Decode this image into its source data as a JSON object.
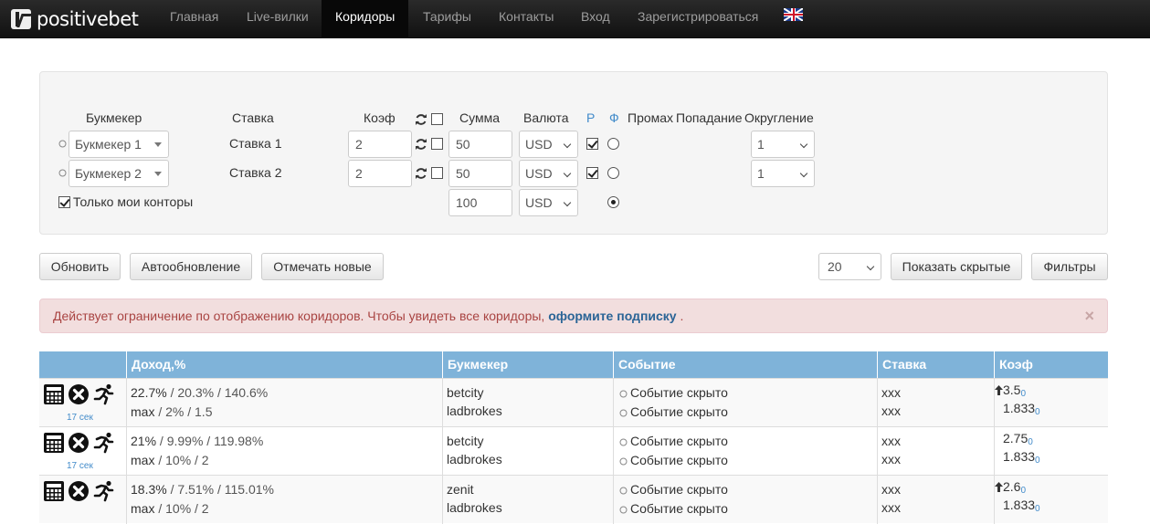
{
  "brand": "positivebet",
  "nav": [
    "Главная",
    "Live-вилки",
    "Коридоры",
    "Тарифы",
    "Контакты",
    "Вход",
    "Зарегистрироваться"
  ],
  "form": {
    "headers": {
      "bookmaker": "Букмекер",
      "bet": "Ставка",
      "coef": "Коэф",
      "sum": "Сумма",
      "currency": "Валюта",
      "r": "Р",
      "f": "Ф",
      "promah": "Промах",
      "popadanie": "Попадание",
      "rounding": "Округление"
    },
    "rows": [
      {
        "bookmaker": "Букмекер 1",
        "bet": "Ставка 1",
        "coef": "2",
        "sum": "50",
        "currency": "USD",
        "rounding": "1"
      },
      {
        "bookmaker": "Букмекер 2",
        "bet": "Ставка 2",
        "coef": "2",
        "sum": "50",
        "currency": "USD",
        "rounding": "1"
      }
    ],
    "total_sum": "100",
    "total_currency": "USD",
    "only_mine_label": "Только мои конторы"
  },
  "toolbar": {
    "refresh": "Обновить",
    "autorefresh": "Автообновление",
    "mark_new": "Отмечать новые",
    "page_size": "20",
    "show_hidden": "Показать скрытые",
    "filters": "Фильтры"
  },
  "alert": {
    "text": "Действует ограничение по отображению коридоров. Чтобы увидеть все коридоры,",
    "link": "оформите подписку",
    "tail": ".",
    "close": "×"
  },
  "table": {
    "headers": [
      "Доход,%",
      "Букмекер",
      "Событие",
      "Ставка",
      "Коэф"
    ],
    "rows": [
      {
        "age": "17 сек",
        "income_a": "22.7%",
        "income_b": " / 20.3% / 140.6%",
        "stats_a": "max",
        "stats_b": " / 2% / 1.5",
        "bk1": "betcity",
        "bk2": "ladbrokes",
        "ev1": "Событие скрыто",
        "ev2": "Событие скрыто",
        "bet1": "xxx",
        "bet2": "xxx",
        "k1": "3.5",
        "k1s": "0",
        "k2": "1.833",
        "k2s": "0"
      },
      {
        "age": "17 сек",
        "income_a": "21%",
        "income_b": " / 9.99% / 119.98%",
        "stats_a": "max",
        "stats_b": " / 10% / 2",
        "bk1": "betcity",
        "bk2": "ladbrokes",
        "ev1": "Событие скрыто",
        "ev2": "Событие скрыто",
        "bet1": "xxx",
        "bet2": "xxx",
        "k1": "2.75",
        "k1s": "0",
        "k2": "1.833",
        "k2s": "0"
      },
      {
        "age": "",
        "income_a": "18.3%",
        "income_b": " / 7.51% / 115.01%",
        "stats_a": "max",
        "stats_b": " / 10% / 2",
        "bk1": "zenit",
        "bk2": "ladbrokes",
        "ev1": "Событие скрыто",
        "ev2": "Событие скрыто",
        "bet1": "xxx",
        "bet2": "xxx",
        "k1": "2.6",
        "k1s": "0",
        "k2": "1.833",
        "k2s": "0"
      }
    ]
  }
}
